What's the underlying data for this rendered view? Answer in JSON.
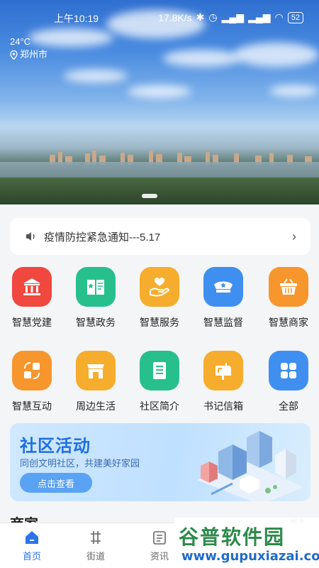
{
  "status_bar": {
    "time": "上午10:19",
    "network_speed": "17.8K/s",
    "battery": "52"
  },
  "weather": {
    "temperature": "24°C",
    "city": "郑州市"
  },
  "notice": {
    "text": "疫情防控紧急通知---5.17"
  },
  "grid": [
    {
      "label": "智慧党建",
      "icon": "building-icon",
      "color": "#f0473f"
    },
    {
      "label": "智慧政务",
      "icon": "book-icon",
      "color": "#27c08c"
    },
    {
      "label": "智慧服务",
      "icon": "heart-hand-icon",
      "color": "#f6ac2c"
    },
    {
      "label": "智慧监督",
      "icon": "police-cap-icon",
      "color": "#3f8ff0"
    },
    {
      "label": "智慧商家",
      "icon": "basket-icon",
      "color": "#f7962d"
    },
    {
      "label": "智慧互动",
      "icon": "interaction-icon",
      "color": "#f7962d"
    },
    {
      "label": "周边生活",
      "icon": "shop-icon",
      "color": "#f6ac2c"
    },
    {
      "label": "社区简介",
      "icon": "document-icon",
      "color": "#27c08c"
    },
    {
      "label": "书记信箱",
      "icon": "mailbox-icon",
      "color": "#f6ac2c"
    },
    {
      "label": "全部",
      "icon": "grid-icon",
      "color": "#3f8ff0"
    }
  ],
  "banner": {
    "title": "社区活动",
    "subtitle": "同创文明社区，共建美好家园",
    "button": "点击查看"
  },
  "section": {
    "title": "商家",
    "more": "更多"
  },
  "tabs": [
    {
      "label": "首页",
      "icon": "home-icon",
      "active": true
    },
    {
      "label": "街道",
      "icon": "street-icon",
      "active": false
    },
    {
      "label": "资讯",
      "icon": "news-icon",
      "active": false
    }
  ],
  "watermark": {
    "text_cn": "谷普软件园",
    "text_url": "www.gupuxiazai.com"
  },
  "colors": {
    "accent": "#2b74e8",
    "background": "#f4f5f7"
  }
}
